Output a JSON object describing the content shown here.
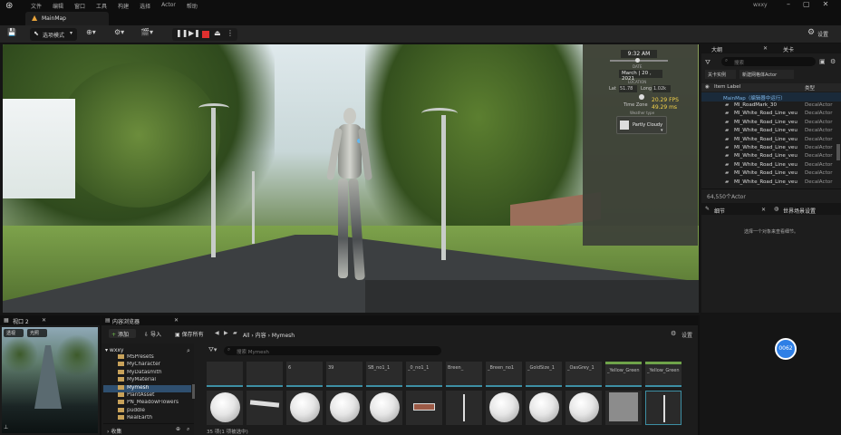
{
  "menubar": {
    "items": [
      "文件",
      "编辑",
      "窗口",
      "工具",
      "构建",
      "选择",
      "Actor",
      "帮助"
    ],
    "user": "wxxy"
  },
  "tab": {
    "label": "MainMap"
  },
  "toolbar": {
    "mode_label": "选项模式",
    "settings_label": "设置"
  },
  "stats": {
    "time": "9:32 AM",
    "date_label": "DATE",
    "date_month": "March",
    "date_day": "20",
    "date_year": "2021",
    "location_label": "LOCATION",
    "lat_label": "Lat",
    "lat": "51.78",
    "long_label": "Long",
    "long": "1.02k",
    "timezone_label": "Time Zone",
    "fps": "20.29 FPS",
    "ms": "49.29 ms",
    "weather_label": "Weather type",
    "weather": "Partly Cloudy"
  },
  "outliner": {
    "tab1": "大纲",
    "tab2": "关卡",
    "search_placeholder": "搜索",
    "btn_close_actor": "关卡实例",
    "btn_new_actor": "新建网格体Actor",
    "col_label": "Item Label",
    "col_type": "类型",
    "scene_root": "MainMap（编辑器中运行）",
    "rows": [
      {
        "name": "MI_RoadMark_30",
        "type": "DecalActor"
      },
      {
        "name": "MI_White_Road_Line_veu",
        "type": "DecalActor"
      },
      {
        "name": "MI_White_Road_Line_veu",
        "type": "DecalActor"
      },
      {
        "name": "MI_White_Road_Line_veu",
        "type": "DecalActor"
      },
      {
        "name": "MI_White_Road_Line_veu",
        "type": "DecalActor"
      },
      {
        "name": "MI_White_Road_Line_veu",
        "type": "DecalActor"
      },
      {
        "name": "MI_White_Road_Line_veu",
        "type": "DecalActor"
      },
      {
        "name": "MI_White_Road_Line_veu",
        "type": "DecalActor"
      },
      {
        "name": "MI_White_Road_Line_veu",
        "type": "DecalActor"
      },
      {
        "name": "MI_White_Road_Line_veu",
        "type": "DecalActor"
      }
    ],
    "count": "64,550个Actor"
  },
  "details": {
    "tab1": "细节",
    "tab2": "世界场景设置",
    "empty_text": "选择一个对象来查看细节。"
  },
  "viewport2": {
    "title": "视口 2",
    "btn1": "透视",
    "btn2": "光照"
  },
  "content_browser": {
    "title": "内容浏览器",
    "add": "添加",
    "import": "导入",
    "save_all": "保存所有",
    "path": [
      "All",
      "内容",
      "Mymesh"
    ],
    "settings": "设置",
    "root": "wxxy",
    "search_placeholder": "搜索 Mymesh",
    "folders": [
      "MSPresets",
      "MyCharacter",
      "MyDatasmith",
      "MyMaterial",
      "Mymesh",
      "PlantAsset",
      "PN_MeadowFlowers",
      "puddle",
      "RealEarth"
    ],
    "selected_folder": "Mymesh",
    "collections": "收集",
    "status": "35 项(1 项被选中)",
    "tiles": [
      "",
      "",
      "6",
      "39",
      "SB_no1_1",
      "_0_no1_1",
      "Breen_",
      "_Breen_no1",
      "_GoldSize_1",
      "_OasGrey_1",
      "_Yellow_Green",
      "_Yellow_Green"
    ]
  },
  "fps_badge": "0062"
}
